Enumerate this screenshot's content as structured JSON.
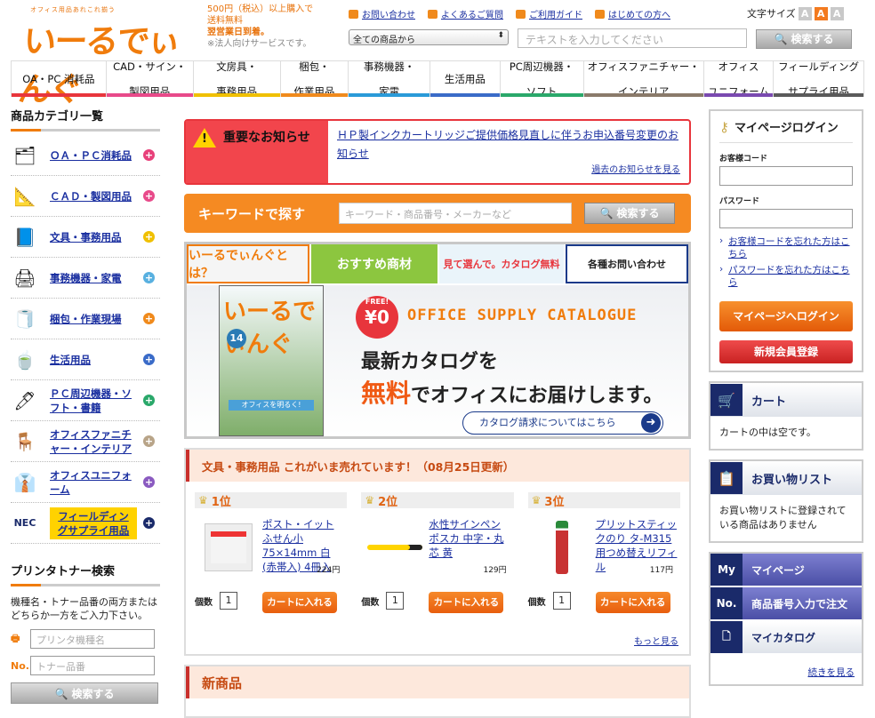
{
  "header": {
    "logo_tagline": "オフィス用品あれこれ揃う",
    "logo_text": "いーるでぃんぐ",
    "promo": [
      "500円（税込）以上購入で",
      "送料無料",
      "翌営業日到着。",
      "※法人向けサービスです。"
    ],
    "links": [
      "お問い合わせ",
      "よくあるご質問",
      "ご利用ガイド",
      "はじめての方へ"
    ],
    "fontsize_label": "文字サイズ",
    "fontsize_opts": [
      "A",
      "A",
      "A"
    ],
    "category_select": "全ての商品から",
    "search_placeholder": "テキストを入力してください",
    "search_button": "🔍 検索する"
  },
  "nav": [
    {
      "l1": "OA・PC 消耗品",
      "l2": "",
      "c": "#e8353c"
    },
    {
      "l1": "CAD・サイン・",
      "l2": "製図用品",
      "c": "#e84a8a"
    },
    {
      "l1": "文房具・",
      "l2": "事務用品",
      "c": "#f0c000"
    },
    {
      "l1": "梱包・",
      "l2": "作業用品",
      "c": "#f08a1c"
    },
    {
      "l1": "事務機器・",
      "l2": "家電",
      "c": "#2a9ad8"
    },
    {
      "l1": "生活用品",
      "l2": "",
      "c": "#3a6bc8"
    },
    {
      "l1": "PC周辺機器・",
      "l2": "ソフト",
      "c": "#2aa86a"
    },
    {
      "l1": "オフィスファニチャー・",
      "l2": "インテリア",
      "c": "#8a7a6a"
    },
    {
      "l1": "オフィス",
      "l2": "ユニフォーム",
      "c": "#7a4ab0"
    },
    {
      "l1": "フィールディング",
      "l2": "サプライ用品",
      "c": "#5a5a5a"
    }
  ],
  "left": {
    "title": "商品カテゴリ一覧",
    "categories": [
      {
        "label": "ＯＡ・ＰＣ消耗品",
        "icon": "🗂",
        "plus": "#e8407a"
      },
      {
        "label": "ＣＡＤ・製図用品",
        "icon": "📐",
        "plus": "#e84a8a"
      },
      {
        "label": "文具・事務用品",
        "icon": "📘",
        "plus": "#f0c000"
      },
      {
        "label": "事務機器・家電",
        "icon": "🖨",
        "plus": "#58b0e0"
      },
      {
        "label": "梱包・作業現場",
        "icon": "🧻",
        "plus": "#f08a1c"
      },
      {
        "label": "生活用品",
        "icon": "🍵",
        "plus": "#3a6bc8"
      },
      {
        "label": "ＰＣ周辺機器・ソフト・書籍",
        "icon": "🖊",
        "plus": "#2aa86a"
      },
      {
        "label": "オフィスファニチャー・インテリア",
        "icon": "🪑",
        "plus": "#b8a488"
      },
      {
        "label": "オフィスユニフォーム",
        "icon": "👔",
        "plus": "#8a5ac0"
      },
      {
        "label": "フィールディングサプライ用品",
        "icon": "NEC",
        "plus": "#1a2a6a"
      }
    ],
    "toner_title": "プリンタトナー検索",
    "toner_desc": "機種名・トナー品番の両方またはどちらか一方をご入力下さい。",
    "toner_printer_placeholder": "プリンタ機種名",
    "toner_no_label": "No.",
    "toner_code_placeholder": "トナー品番",
    "toner_button": "🔍 検索する"
  },
  "notice": {
    "title": "重要なお知らせ",
    "text": "ＨＰ製インクカートリッジご提供価格見直しに伴うお申込番号変更のお知らせ",
    "past": "過去のお知らせを見る"
  },
  "keyword": {
    "title": "キーワードで探す",
    "placeholder": "キーワード・商品番号・メーカーなど",
    "button": "🔍 検索する"
  },
  "banner": {
    "tabs": [
      "いーるでぃんぐとは？",
      "おすすめ商材",
      "見て選んで。カタログ無料",
      "各種お問い合わせ"
    ],
    "cover_logo": "いーるでぃんぐ",
    "cover_num": "14",
    "cover_text": "オフィスを明るく!",
    "free_label": "FREE!",
    "free_price": "¥0",
    "catalog_en": "OFFICE SUPPLY CATALOGUE",
    "headline1": "最新カタログを",
    "headline2_hl": "無料",
    "headline2": "でオフィスにお届けします。",
    "request": "カタログ請求についてはこちら"
  },
  "ranking": {
    "title": "文具・事務用品 これがいま売れています！（08月25日更新）",
    "items": [
      {
        "rank": "1位",
        "name": "ポスト・イット ふせん小 75×14mm 白(赤帯入) 4冊入",
        "price": "224円",
        "qty": "1"
      },
      {
        "rank": "2位",
        "name": "水性サインペン ポスカ 中字・丸芯 黄",
        "price": "129円",
        "qty": "1"
      },
      {
        "rank": "3位",
        "name": "プリットスティックのり タ-M315用つめ替えリフィル",
        "price": "117円",
        "qty": "1"
      }
    ],
    "qty_label": "個数",
    "cart_button": "カートに入れる",
    "more": "もっと見る"
  },
  "newproducts": {
    "title": "新商品"
  },
  "right": {
    "login_title": "マイページログイン",
    "customer_code": "お客様コード",
    "password": "パスワード",
    "forgot_code": "お客様コードを忘れた方はこちら",
    "forgot_pass": "パスワードを忘れた方はこちら",
    "login_button": "マイページへログイン",
    "register_button": "新規会員登録",
    "cart_title": "カート",
    "cart_empty": "カートの中は空です。",
    "list_title": "お買い物リスト",
    "list_empty": "お買い物リストに登録されている商品はありません",
    "mypage": "マイページ",
    "mypage_icon": "My",
    "order_by_no": "商品番号入力で注文",
    "order_icon": "No.",
    "mycatalog": "マイカタログ",
    "more": "続きを見る"
  }
}
